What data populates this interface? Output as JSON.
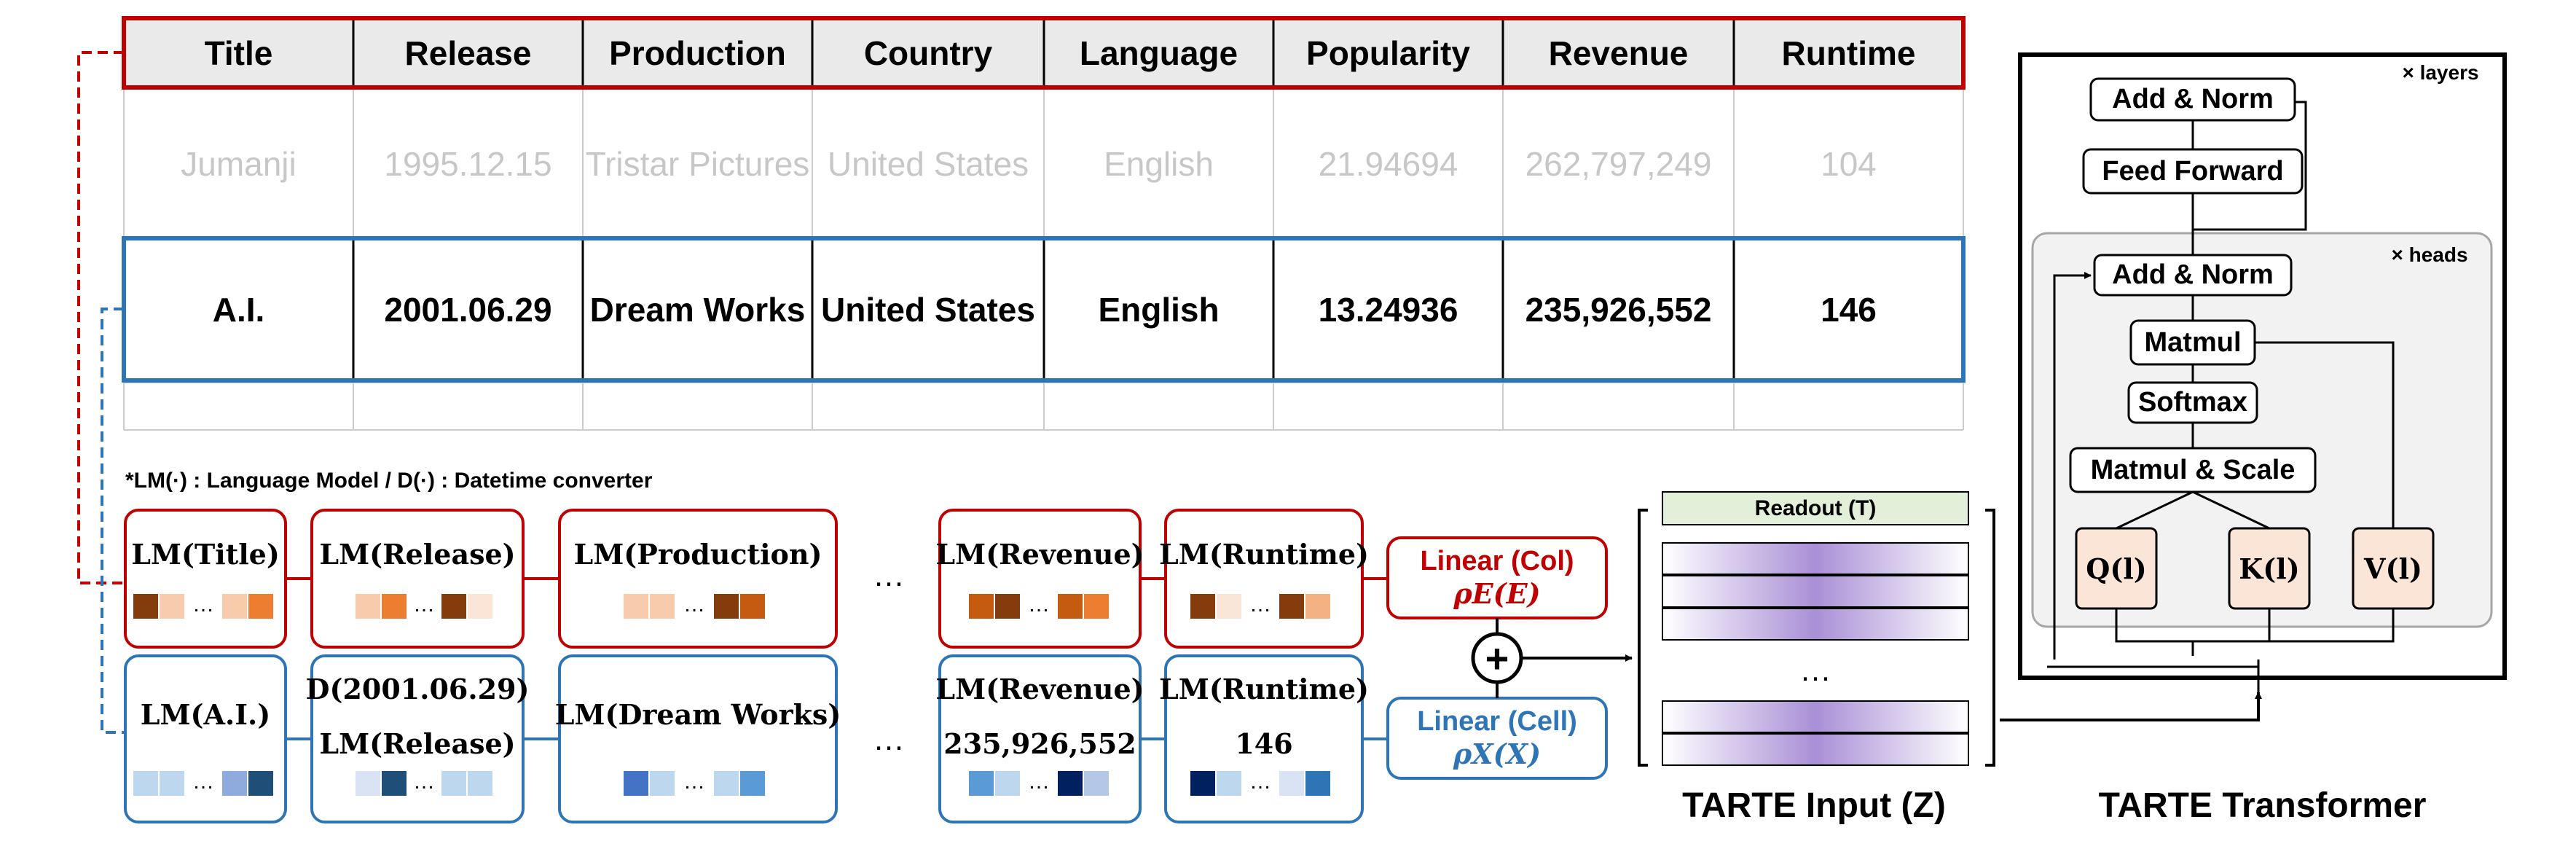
{
  "table": {
    "headers": [
      "Title",
      "Release",
      "Production",
      "Country",
      "Language",
      "Popularity",
      "Revenue",
      "Runtime"
    ],
    "faded_row": [
      "Jumanji",
      "1995.12.15",
      "Tristar Pictures",
      "United States",
      "English",
      "21.94694",
      "262,797,249",
      "104"
    ],
    "highlighted_row": [
      "A.I.",
      "2001.06.29",
      "Dream Works",
      "United States",
      "English",
      "13.24936",
      "235,926,552",
      "146"
    ]
  },
  "footnote": "*LM(·) : Language Model / D(·) : Datetime converter",
  "col_boxes": [
    "LM(Title)",
    "LM(Release)",
    "LM(Production)",
    "LM(Revenue)",
    "LM(Runtime)"
  ],
  "cell_boxes": [
    {
      "top": "LM(A.I.)",
      "bottom": ""
    },
    {
      "top": "D(2001.06.29)",
      "bottom": "LM(Release)"
    },
    {
      "top": "LM(Dream Works)",
      "bottom": ""
    },
    {
      "top": "LM(Revenue)",
      "bottom": "235,926,552"
    },
    {
      "top": "LM(Runtime)",
      "bottom": "146"
    }
  ],
  "ellipsis": "…",
  "linear_col": {
    "label": "Linear (Col)",
    "sub": "ρE(E)"
  },
  "linear_cell": {
    "label": "Linear (Cell)",
    "sub": "ρX(X)"
  },
  "plus": "+",
  "readout": "Readout (T)",
  "input_title": "TARTE Input (Z)",
  "transformer_title": "TARTE Transformer",
  "transformer": {
    "layers_label": "× layers",
    "heads_label": "× heads",
    "add_norm_outer": "Add & Norm",
    "feed_forward": "Feed Forward",
    "add_norm_inner": "Add & Norm",
    "matmul": "Matmul",
    "softmax": "Softmax",
    "matmul_scale": "Matmul & Scale",
    "q": "Q(l)",
    "k": "K(l)",
    "v": "V(l)"
  },
  "colors": {
    "red": "#c00000",
    "blue": "#2e75b6",
    "grid": "#cccccc",
    "header_bg": "#eaeaea",
    "qkv_fill": "#fbe5d6",
    "readout_fill": "#e2f0d9",
    "purple": "#a98fd6"
  }
}
